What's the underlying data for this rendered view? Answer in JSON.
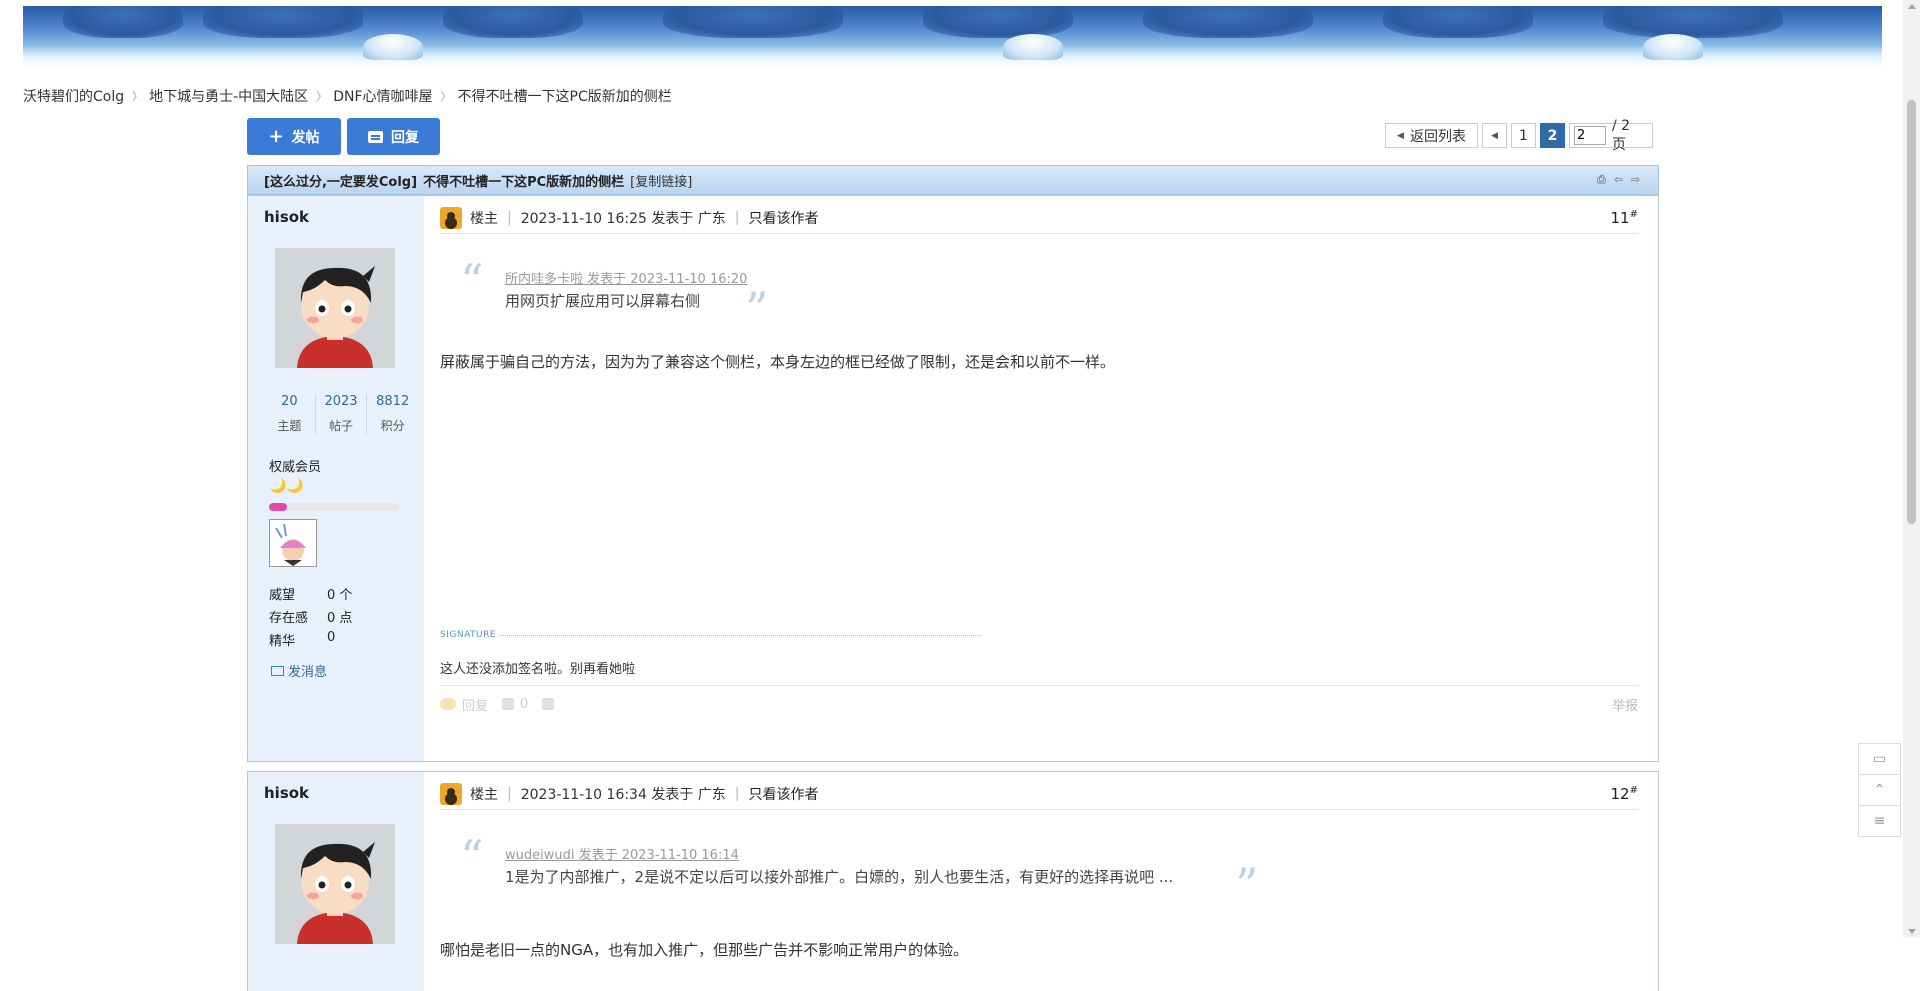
{
  "breadcrumb": [
    {
      "label": "沃特碧们的Colg"
    },
    {
      "label": "地下城与勇士-中国大陆区"
    },
    {
      "label": "DNF心情咖啡屋"
    },
    {
      "label": "不得不吐槽一下这PC版新加的侧栏"
    }
  ],
  "toolbar": {
    "new_post_label": "发帖",
    "reply_label": "回复"
  },
  "pager": {
    "back_label": "返回列表",
    "pages": [
      "1",
      "2"
    ],
    "current_page": "2",
    "page_input_value": "2",
    "total_label": "/ 2 页"
  },
  "thread": {
    "tag": "[这么过分,一定要发Colg]",
    "title": "不得不吐槽一下这PC版新加的侧栏",
    "copy_link": "[复制链接]"
  },
  "posts": [
    {
      "author": "hisok",
      "stats": [
        {
          "num": "20",
          "label": "主题"
        },
        {
          "num": "2023",
          "label": "帖子"
        },
        {
          "num": "8812",
          "label": "积分"
        }
      ],
      "rank": "权威会员",
      "moons": "🌙🌙",
      "info": [
        {
          "k": "威望",
          "v": "0 个"
        },
        {
          "k": "存在感",
          "v": "0 点"
        },
        {
          "k": "精华",
          "v": "0"
        }
      ],
      "send_msg": "发消息",
      "louzhu": "楼主",
      "time": "2023-11-10 16:25 发表于 广东",
      "only_author": "只看该作者",
      "floor": "11",
      "quote_src": "所内哇多卡啦 发表于 2023-11-10 16:20",
      "quote_text": "用网页扩展应用可以屏幕右侧",
      "body": "屏蔽属于骗自己的方法，因为为了兼容这个侧栏，本身左边的框已经做了限制，还是会和以前不一样。",
      "signature_label": "SIGNATURE",
      "signature": "这人还没添加签名啦。别再看她啦",
      "reply_action": "回复",
      "like_count": "0",
      "report": "举报"
    },
    {
      "author": "hisok",
      "louzhu": "楼主",
      "time": "2023-11-10 16:34 发表于 广东",
      "only_author": "只看该作者",
      "floor": "12",
      "quote_src": "wudeiwudi 发表于 2023-11-10 16:14",
      "quote_text": "1是为了内部推广，2是说不定以后可以接外部推广。白嫖的，别人也要生活，有更好的选择再说吧 ...",
      "body": "哪怕是老旧一点的NGA，也有加入推广，但那些广告并不影响正常用户的体验。"
    }
  ],
  "float_tools": [
    "comment-icon",
    "back-to-top-icon",
    "list-icon"
  ],
  "colors": {
    "accent": "#3c7ad8",
    "header_blue": "#b9d4f1",
    "sidebar": "#e8f1fb",
    "active_page": "#2e6ba7"
  }
}
